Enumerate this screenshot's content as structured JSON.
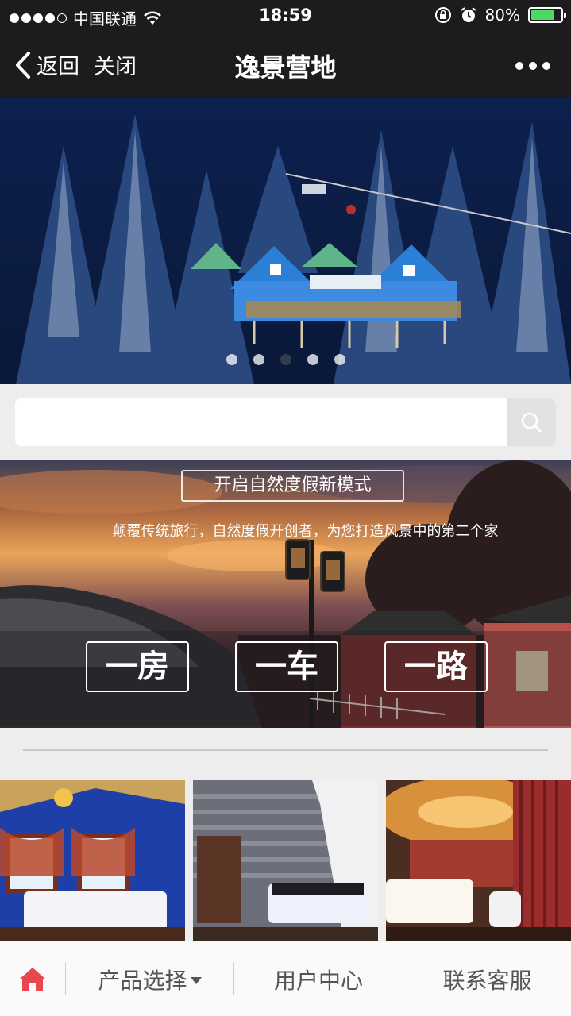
{
  "status_bar": {
    "carrier": "中国联通",
    "time": "18:59",
    "battery": "80%",
    "battery_level": 0.8,
    "signal_dots_filled": 4,
    "icons": [
      "wifi-icon",
      "rotation-lock-icon",
      "alarm-icon",
      "battery-icon"
    ]
  },
  "nav": {
    "back_label": "返回",
    "close_label": "关闭",
    "title": "逸景营地",
    "more_icon": "more-dots-icon"
  },
  "hero": {
    "slide_count": 5,
    "active_index": 2
  },
  "search": {
    "value": "",
    "placeholder": "",
    "button_icon": "search-icon"
  },
  "promo": {
    "tagline": "开启自然度假新模式",
    "subtitle": "颠覆传统旅行，自然度假开创者，为您打造风景中的第二个家",
    "boxes": [
      "一房",
      "一车",
      "一路"
    ]
  },
  "rooms": {
    "count": 3
  },
  "tab_bar": {
    "home_icon": "home-icon",
    "home_color": "#e8474f",
    "items": [
      {
        "label": "产品选择",
        "has_caret": true
      },
      {
        "label": "用户中心"
      },
      {
        "label": "联系客服"
      }
    ]
  }
}
